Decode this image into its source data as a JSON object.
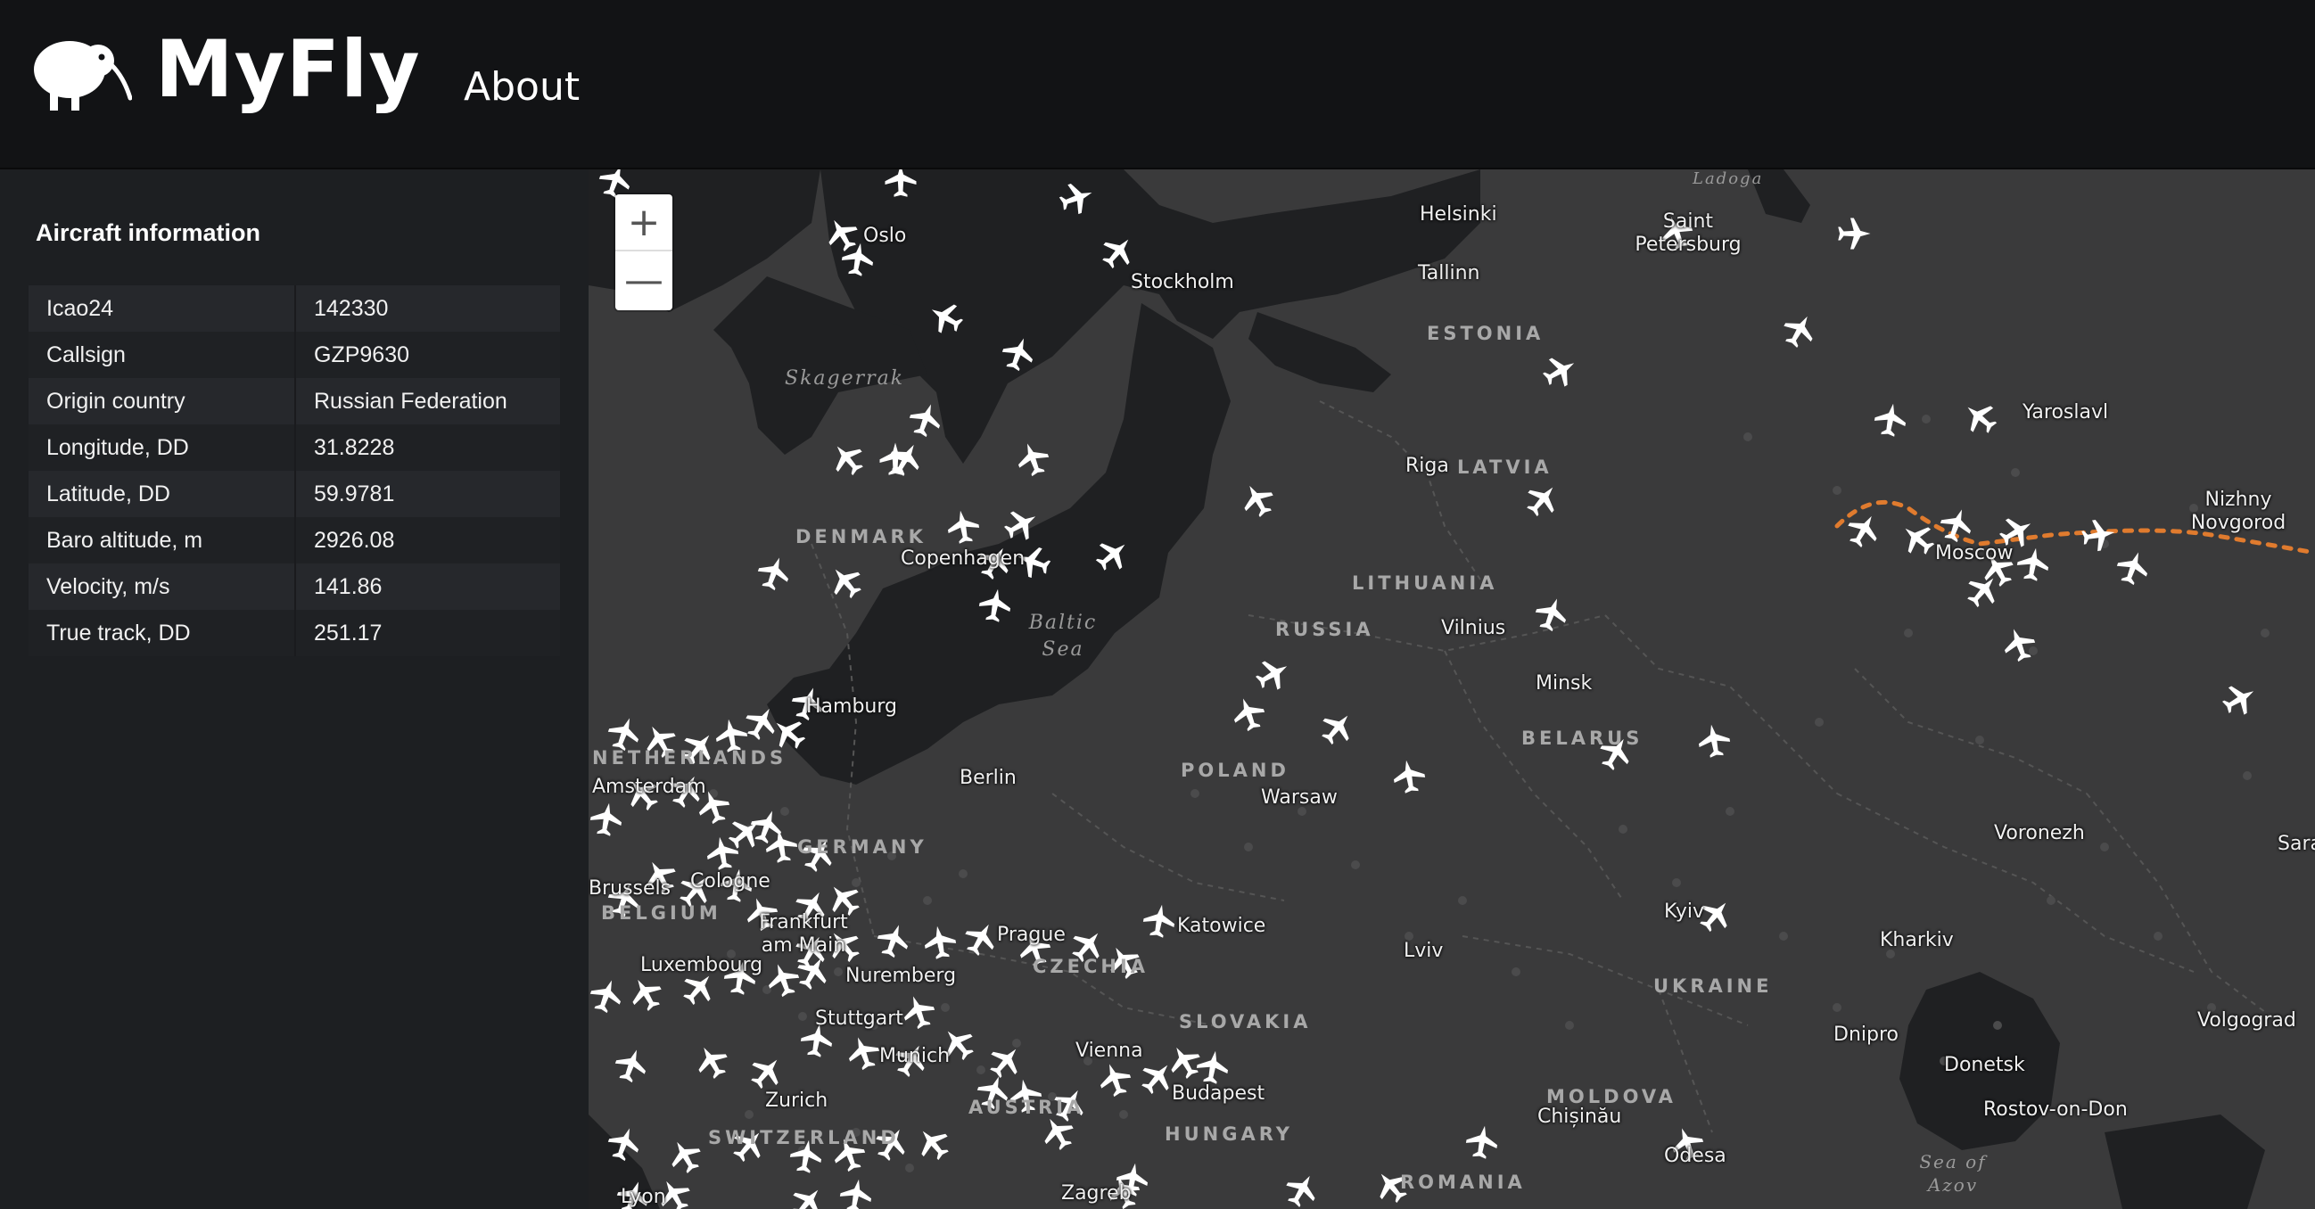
{
  "app": {
    "title": "MyFly",
    "logo_icon": "kiwi-bird-icon"
  },
  "nav": {
    "about_label": "About"
  },
  "panel": {
    "title": "Aircraft information",
    "rows": [
      {
        "label": "Icao24",
        "value": "142330"
      },
      {
        "label": "Callsign",
        "value": "GZP9630"
      },
      {
        "label": "Origin country",
        "value": "Russian Federation"
      },
      {
        "label": "Longitude, DD",
        "value": "31.8228"
      },
      {
        "label": "Latitude, DD",
        "value": "59.9781"
      },
      {
        "label": "Baro altitude, m",
        "value": "2926.08"
      },
      {
        "label": "Velocity, m/s",
        "value": "141.86"
      },
      {
        "label": "True track, DD",
        "value": "251.17"
      }
    ]
  },
  "map": {
    "zoom_in_label": "+",
    "zoom_out_label": "—",
    "track_color": "#e07b2e",
    "aircraft_icon": "airplane-icon",
    "cities": [
      "Oslo",
      "Stockholm",
      "Helsinki",
      "Saint Petersburg",
      "Tallinn",
      "Riga",
      "Copenhagen",
      "Vilnius",
      "Hamburg",
      "Minsk",
      "Amsterdam",
      "Berlin",
      "Warsaw",
      "Brussels",
      "Cologne",
      "Frankfurt am Main",
      "Luxembourg",
      "Prague",
      "Katowice",
      "Nuremberg",
      "Stuttgart",
      "Munich",
      "Vienna",
      "Budapest",
      "Zurich",
      "Lyon",
      "Zagreb",
      "Lviv",
      "Kyiv",
      "Kharkiv",
      "Dnipro",
      "Donetsk",
      "Rostov-on-Don",
      "Chișinău",
      "Odesa",
      "Yaroslavl",
      "Nizhny Novgorod",
      "Moscow",
      "Voronezh",
      "Volgograd",
      "Sara"
    ],
    "countries": [
      "ESTONIA",
      "LATVIA",
      "LITHUANIA",
      "RUSSIA",
      "BELARUS",
      "DENMARK",
      "NETHERLANDS",
      "POLAND",
      "GERMANY",
      "BELGIUM",
      "CZECHIA",
      "SLOVAKIA",
      "AUSTRIA",
      "HUNGARY",
      "SWITZERLAND",
      "UKRAINE",
      "MOLDOVA",
      "ROMANIA"
    ],
    "seas": [
      "Skagerrak",
      "Baltic Sea",
      "Sea of Azov",
      "Ladoga"
    ]
  }
}
